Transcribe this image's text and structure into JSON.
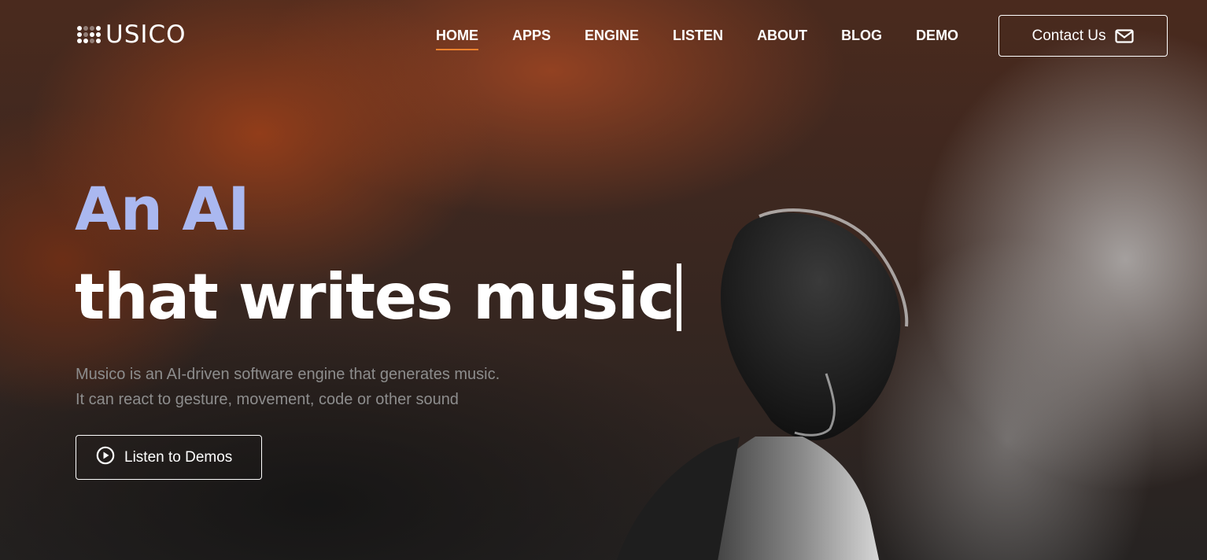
{
  "brand": {
    "name": "USICO"
  },
  "nav": {
    "items": [
      {
        "label": "HOME",
        "active": true
      },
      {
        "label": "APPS",
        "active": false
      },
      {
        "label": "ENGINE",
        "active": false
      },
      {
        "label": "LISTEN",
        "active": false
      },
      {
        "label": "ABOUT",
        "active": false
      },
      {
        "label": "BLOG",
        "active": false
      },
      {
        "label": "DEMO",
        "active": false
      }
    ],
    "contact_label": "Contact Us",
    "contact_icon": "envelope-icon"
  },
  "hero": {
    "title_line1": "An AI",
    "title_line2": "that writes music",
    "description_line1": "Musico is an AI-driven software engine that generates music.",
    "description_line2": "It can react to gesture, movement, code or other sound",
    "cta_label": "Listen to Demos",
    "cta_icon": "play-circle-icon"
  },
  "colors": {
    "accent": "#f0822e",
    "title_highlight": "#aab8f0",
    "description": "#8d8d8d"
  }
}
